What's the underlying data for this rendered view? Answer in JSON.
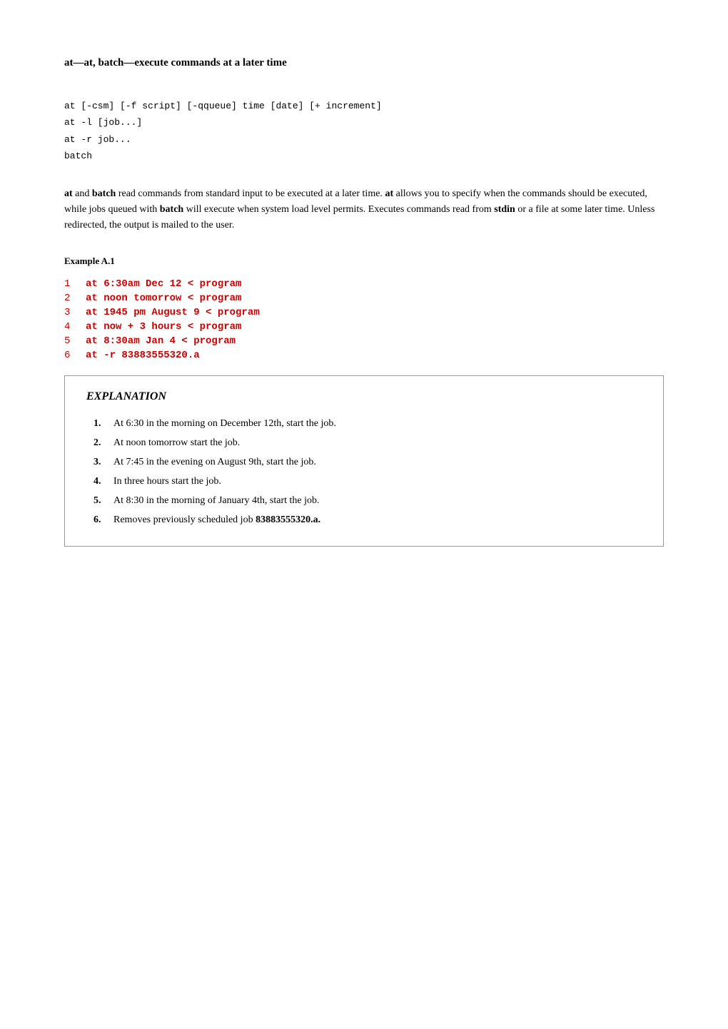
{
  "page": {
    "title": "at—at, batch—execute commands at a later time",
    "synopsis": {
      "lines": [
        "at [-csm] [-f script] [-qqueue] time [date] [+ increment]",
        "at -l [job...]",
        "at -r job...",
        "batch"
      ]
    },
    "description": {
      "text_before_at": "",
      "at_bold": "at",
      "text_and": " and ",
      "batch_bold": "batch",
      "text_1": " read commands from standard input to be executed at a later time. ",
      "at_bold2": "at",
      "text_2": " allows you to specify when the commands should be executed, while jobs queued with ",
      "batch_bold2": "batch",
      "text_3": " will execute when system load level permits. Executes commands read from ",
      "stdin_bold": "stdin",
      "text_4": " or a file at some later time. Unless redirected, the output is mailed to the user."
    },
    "example_label": "Example A.1",
    "code_lines": [
      {
        "num": "1",
        "code": "at 6:30am Dec 12 < program"
      },
      {
        "num": "2",
        "code": "at noon tomorrow < program"
      },
      {
        "num": "3",
        "code": "at 1945 pm August 9 < program"
      },
      {
        "num": "4",
        "code": "at now + 3 hours < program"
      },
      {
        "num": "5",
        "code": "at 8:30am Jan 4 < program"
      },
      {
        "num": "6",
        "code": "at -r 83883555320.a"
      }
    ],
    "explanation": {
      "title": "EXPLANATION",
      "items": [
        {
          "num": "1.",
          "text": "At 6:30 in the morning on December 12th, start the job."
        },
        {
          "num": "2.",
          "text": "At noon tomorrow start the job."
        },
        {
          "num": "3.",
          "text": "At 7:45 in the evening on August 9th, start the job."
        },
        {
          "num": "4.",
          "text": "In three hours start the job."
        },
        {
          "num": "5.",
          "text": "At 8:30 in the morning of January 4th, start the job."
        },
        {
          "num": "6.",
          "text": "Removes previously scheduled job ",
          "bold_suffix": "83883555320.a."
        }
      ]
    }
  }
}
